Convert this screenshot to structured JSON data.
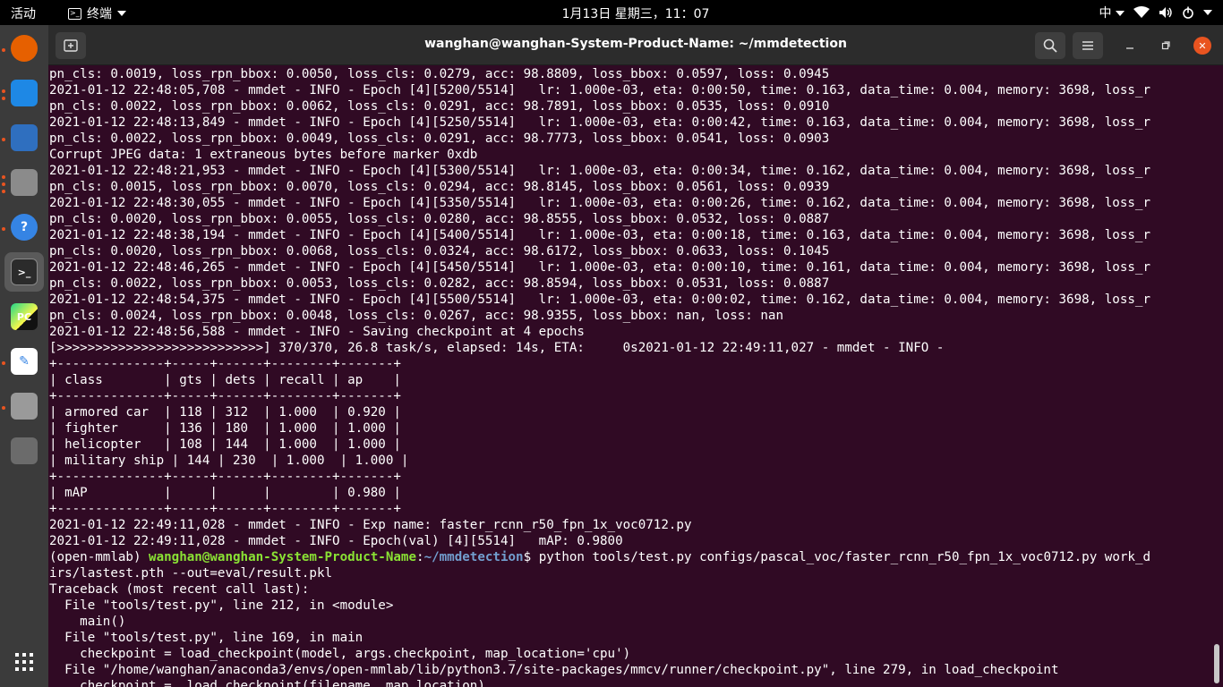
{
  "topbar": {
    "activities": "活动",
    "app_name": "终端",
    "clock": "1月13日 星期三，11：07",
    "input_method": "中"
  },
  "dock": {
    "items": [
      {
        "name": "firefox-icon",
        "glyph": "",
        "color": "#e66000"
      },
      {
        "name": "software-icon",
        "glyph": "",
        "color": "#1e88e5"
      },
      {
        "name": "writer-icon",
        "glyph": "",
        "color": "#2f6fbf"
      },
      {
        "name": "files-icon",
        "glyph": "",
        "color": "#8b8b8b"
      },
      {
        "name": "help-icon",
        "glyph": "?",
        "color": "#3584e4"
      },
      {
        "name": "terminal-icon",
        "glyph": ">_",
        "color": "#2b2b2b"
      },
      {
        "name": "pycharm-icon",
        "glyph": "PC",
        "color": "#111111"
      },
      {
        "name": "text-editor-icon",
        "glyph": "✎",
        "color": "#ffffff"
      },
      {
        "name": "image-viewer-icon",
        "glyph": "",
        "color": "#9a9a9a"
      },
      {
        "name": "usb-icon",
        "glyph": "",
        "color": "#6b6b6b"
      }
    ],
    "show_apps": "⋮⋮⋮"
  },
  "window": {
    "title": "wanghan@wanghan-System-Product-Name: ~/mmdetection"
  },
  "terminal": {
    "lines": [
      "pn_cls: 0.0019, loss_rpn_bbox: 0.0050, loss_cls: 0.0279, acc: 98.8809, loss_bbox: 0.0597, loss: 0.0945",
      "2021-01-12 22:48:05,708 - mmdet - INFO - Epoch [4][5200/5514]   lr: 1.000e-03, eta: 0:00:50, time: 0.163, data_time: 0.004, memory: 3698, loss_r",
      "pn_cls: 0.0022, loss_rpn_bbox: 0.0062, loss_cls: 0.0291, acc: 98.7891, loss_bbox: 0.0535, loss: 0.0910",
      "2021-01-12 22:48:13,849 - mmdet - INFO - Epoch [4][5250/5514]   lr: 1.000e-03, eta: 0:00:42, time: 0.163, data_time: 0.004, memory: 3698, loss_r",
      "pn_cls: 0.0022, loss_rpn_bbox: 0.0049, loss_cls: 0.0291, acc: 98.7773, loss_bbox: 0.0541, loss: 0.0903",
      "Corrupt JPEG data: 1 extraneous bytes before marker 0xdb",
      "2021-01-12 22:48:21,953 - mmdet - INFO - Epoch [4][5300/5514]   lr: 1.000e-03, eta: 0:00:34, time: 0.162, data_time: 0.004, memory: 3698, loss_r",
      "pn_cls: 0.0015, loss_rpn_bbox: 0.0070, loss_cls: 0.0294, acc: 98.8145, loss_bbox: 0.0561, loss: 0.0939",
      "2021-01-12 22:48:30,055 - mmdet - INFO - Epoch [4][5350/5514]   lr: 1.000e-03, eta: 0:00:26, time: 0.162, data_time: 0.004, memory: 3698, loss_r",
      "pn_cls: 0.0020, loss_rpn_bbox: 0.0055, loss_cls: 0.0280, acc: 98.8555, loss_bbox: 0.0532, loss: 0.0887",
      "2021-01-12 22:48:38,194 - mmdet - INFO - Epoch [4][5400/5514]   lr: 1.000e-03, eta: 0:00:18, time: 0.163, data_time: 0.004, memory: 3698, loss_r",
      "pn_cls: 0.0020, loss_rpn_bbox: 0.0068, loss_cls: 0.0324, acc: 98.6172, loss_bbox: 0.0633, loss: 0.1045",
      "2021-01-12 22:48:46,265 - mmdet - INFO - Epoch [4][5450/5514]   lr: 1.000e-03, eta: 0:00:10, time: 0.161, data_time: 0.004, memory: 3698, loss_r",
      "pn_cls: 0.0022, loss_rpn_bbox: 0.0053, loss_cls: 0.0282, acc: 98.8594, loss_bbox: 0.0531, loss: 0.0887",
      "2021-01-12 22:48:54,375 - mmdet - INFO - Epoch [4][5500/5514]   lr: 1.000e-03, eta: 0:00:02, time: 0.162, data_time: 0.004, memory: 3698, loss_r",
      "pn_cls: 0.0024, loss_rpn_bbox: 0.0048, loss_cls: 0.0267, acc: 98.9355, loss_bbox: nan, loss: nan",
      "2021-01-12 22:48:56,588 - mmdet - INFO - Saving checkpoint at 4 epochs",
      "[>>>>>>>>>>>>>>>>>>>>>>>>>>>] 370/370, 26.8 task/s, elapsed: 14s, ETA:     0s2021-01-12 22:49:11,027 - mmdet - INFO -",
      "+--------------+-----+------+--------+-------+",
      "| class        | gts | dets | recall | ap    |",
      "+--------------+-----+------+--------+-------+",
      "| armored car  | 118 | 312  | 1.000  | 0.920 |",
      "| fighter      | 136 | 180  | 1.000  | 1.000 |",
      "| helicopter   | 108 | 144  | 1.000  | 1.000 |",
      "| military ship | 144 | 230  | 1.000  | 1.000 |",
      "+--------------+-----+------+--------+-------+",
      "| mAP          |     |      |        | 0.980 |",
      "+--------------+-----+------+--------+-------+",
      "2021-01-12 22:49:11,028 - mmdet - INFO - Exp name: faster_rcnn_r50_fpn_1x_voc0712.py",
      "2021-01-12 22:49:11,028 - mmdet - INFO - Epoch(val) [4][5514]   mAP: 0.9800"
    ],
    "prompt": {
      "env": "(open-mmlab) ",
      "user_host": "wanghan@wanghan-System-Product-Name",
      "sep": ":",
      "path": "~/mmdetection",
      "symbol": "$ ",
      "command": "python tools/test.py configs/pascal_voc/faster_rcnn_r50_fpn_1x_voc0712.py work_d"
    },
    "after_lines": [
      "irs/lastest.pth --out=eval/result.pkl",
      "Traceback (most recent call last):",
      "  File \"tools/test.py\", line 212, in <module>",
      "    main()",
      "  File \"tools/test.py\", line 169, in main",
      "    checkpoint = load_checkpoint(model, args.checkpoint, map_location='cpu')",
      "  File \"/home/wanghan/anaconda3/envs/open-mmlab/lib/python3.7/site-packages/mmcv/runner/checkpoint.py\", line 279, in load_checkpoint",
      "    checkpoint = _load_checkpoint(filename, map_location)"
    ]
  }
}
